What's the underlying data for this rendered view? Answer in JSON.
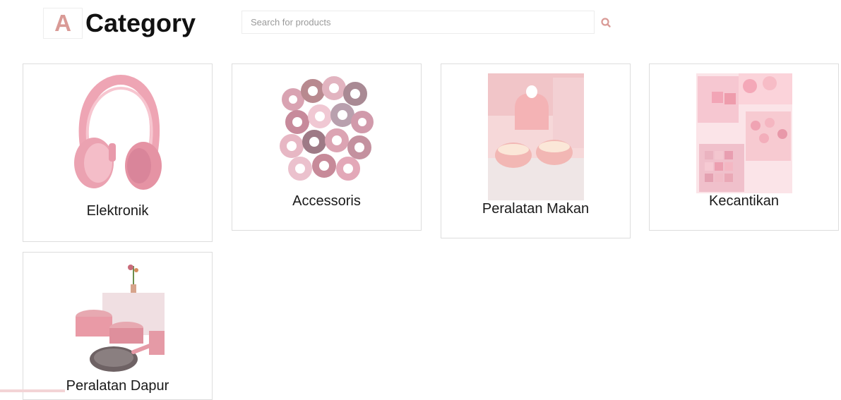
{
  "header": {
    "logo_letter": "A",
    "title": "Category"
  },
  "search": {
    "placeholder": "Search for products",
    "value": "",
    "button_icon": "search-icon"
  },
  "colors": {
    "accent": "#d99a96",
    "card_border": "#dddddd",
    "title": "#111111"
  },
  "categories": [
    {
      "label": "Elektronik",
      "icon": "headphones"
    },
    {
      "label": "Accessoris",
      "icon": "scrunchies"
    },
    {
      "label": "Peralatan Makan",
      "icon": "tea-set"
    },
    {
      "label": "Kecantikan",
      "icon": "makeup-palette"
    },
    {
      "label": "Peralatan Dapur",
      "icon": "cookware-set"
    }
  ]
}
